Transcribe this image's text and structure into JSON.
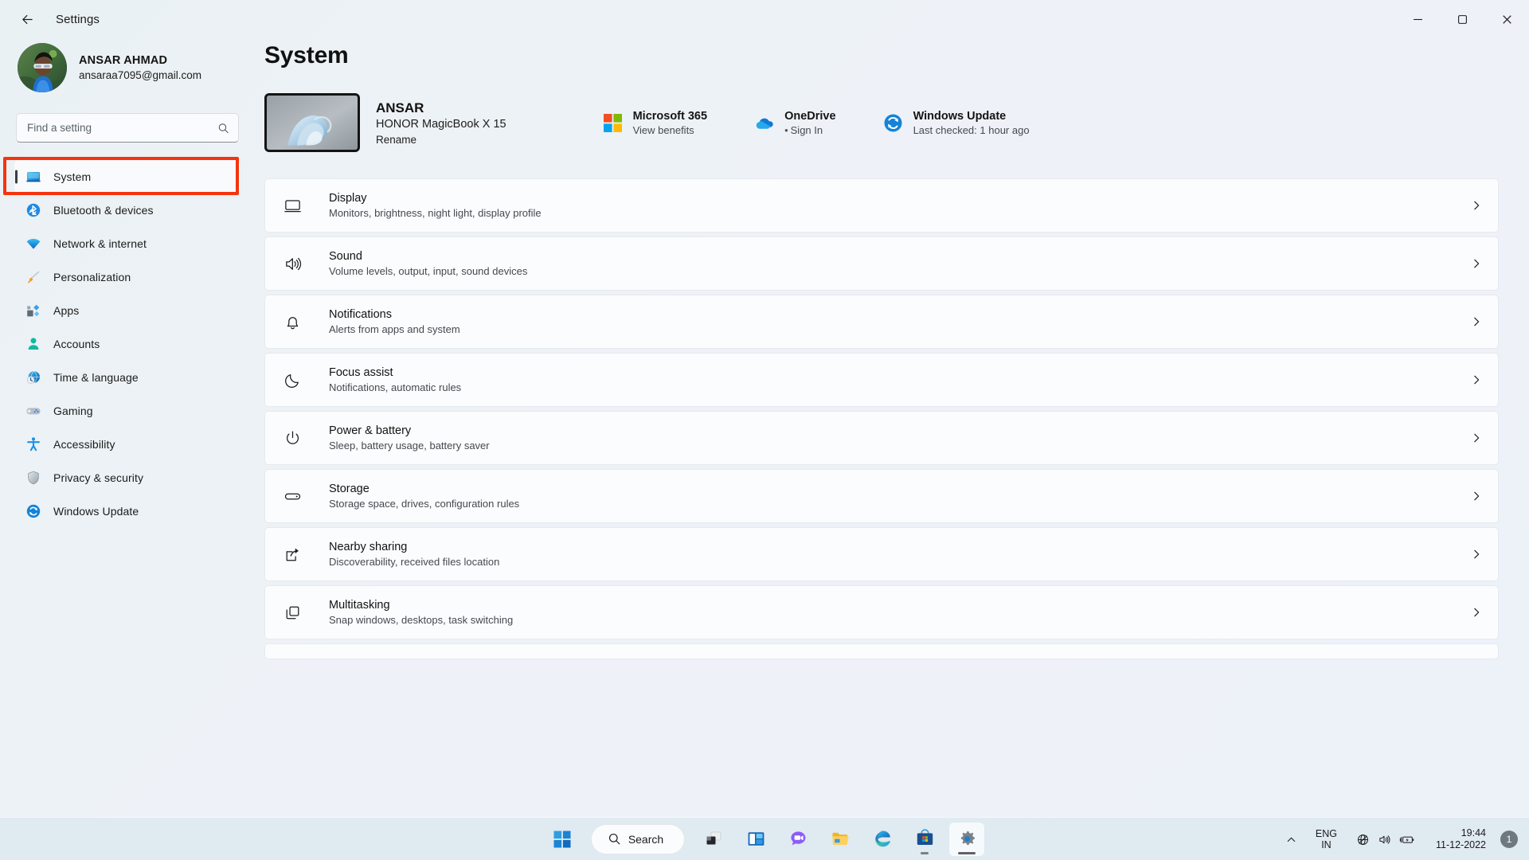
{
  "window": {
    "title": "Settings",
    "back_icon": "back-arrow-icon",
    "minimize_icon": "minimize-icon",
    "maximize_icon": "maximize-icon",
    "close_icon": "close-icon"
  },
  "account": {
    "name": "ANSAR AHMAD",
    "email": "ansaraa7095@gmail.com",
    "avatar_icon": "user-avatar"
  },
  "search": {
    "placeholder": "Find a setting",
    "value": "",
    "icon": "search-icon"
  },
  "sidebar": {
    "items": [
      {
        "label": "System",
        "icon": "system-icon",
        "active": true
      },
      {
        "label": "Bluetooth & devices",
        "icon": "bluetooth-icon",
        "active": false
      },
      {
        "label": "Network & internet",
        "icon": "network-icon",
        "active": false
      },
      {
        "label": "Personalization",
        "icon": "personalization-icon",
        "active": false
      },
      {
        "label": "Apps",
        "icon": "apps-icon",
        "active": false
      },
      {
        "label": "Accounts",
        "icon": "accounts-icon",
        "active": false
      },
      {
        "label": "Time & language",
        "icon": "time-language-icon",
        "active": false
      },
      {
        "label": "Gaming",
        "icon": "gaming-icon",
        "active": false
      },
      {
        "label": "Accessibility",
        "icon": "accessibility-icon",
        "active": false
      },
      {
        "label": "Privacy & security",
        "icon": "privacy-security-icon",
        "active": false
      },
      {
        "label": "Windows Update",
        "icon": "windows-update-icon",
        "active": false
      }
    ]
  },
  "annotation": {
    "color": "#f5340d",
    "target": "System"
  },
  "main": {
    "page_title": "System",
    "device": {
      "name": "ANSAR",
      "model": "HONOR MagicBook X 15",
      "rename_label": "Rename"
    },
    "quick_links": [
      {
        "title": "Microsoft 365",
        "subtitle": "View benefits",
        "icon": "microsoft-365-icon",
        "bullet": ""
      },
      {
        "title": "OneDrive",
        "subtitle": "Sign In",
        "icon": "onedrive-icon",
        "bullet": "•"
      },
      {
        "title": "Windows Update",
        "subtitle": "Last checked: 1 hour ago",
        "icon": "windows-update-icon",
        "bullet": ""
      }
    ],
    "settings_rows": [
      {
        "title": "Display",
        "subtitle": "Monitors, brightness, night light, display profile",
        "icon": "display-icon"
      },
      {
        "title": "Sound",
        "subtitle": "Volume levels, output, input, sound devices",
        "icon": "sound-icon"
      },
      {
        "title": "Notifications",
        "subtitle": "Alerts from apps and system",
        "icon": "notifications-icon"
      },
      {
        "title": "Focus assist",
        "subtitle": "Notifications, automatic rules",
        "icon": "focus-assist-icon"
      },
      {
        "title": "Power & battery",
        "subtitle": "Sleep, battery usage, battery saver",
        "icon": "power-battery-icon"
      },
      {
        "title": "Storage",
        "subtitle": "Storage space, drives, configuration rules",
        "icon": "storage-icon"
      },
      {
        "title": "Nearby sharing",
        "subtitle": "Discoverability, received files location",
        "icon": "nearby-sharing-icon"
      },
      {
        "title": "Multitasking",
        "subtitle": "Snap windows, desktops, task switching",
        "icon": "multitasking-icon"
      }
    ]
  },
  "taskbar": {
    "start_icon": "windows-start-icon",
    "search_label": "Search",
    "search_icon": "search-icon",
    "buttons": [
      {
        "icon": "task-view-icon",
        "name": "task-view"
      },
      {
        "icon": "widgets-icon",
        "name": "widgets"
      },
      {
        "icon": "chat-icon",
        "name": "chat"
      },
      {
        "icon": "file-explorer-icon",
        "name": "file-explorer"
      },
      {
        "icon": "edge-icon",
        "name": "microsoft-edge"
      },
      {
        "icon": "microsoft-store-icon",
        "name": "microsoft-store"
      },
      {
        "icon": "settings-gear-icon",
        "name": "settings"
      }
    ],
    "tray": {
      "chevron_icon": "chevron-up-icon",
      "language": "ENG",
      "region": "IN",
      "network_icon": "network-disconnected-icon",
      "volume_icon": "volume-icon",
      "battery_icon": "battery-charging-icon",
      "time": "19:44",
      "date": "11-12-2022",
      "notification_count": "1"
    }
  }
}
